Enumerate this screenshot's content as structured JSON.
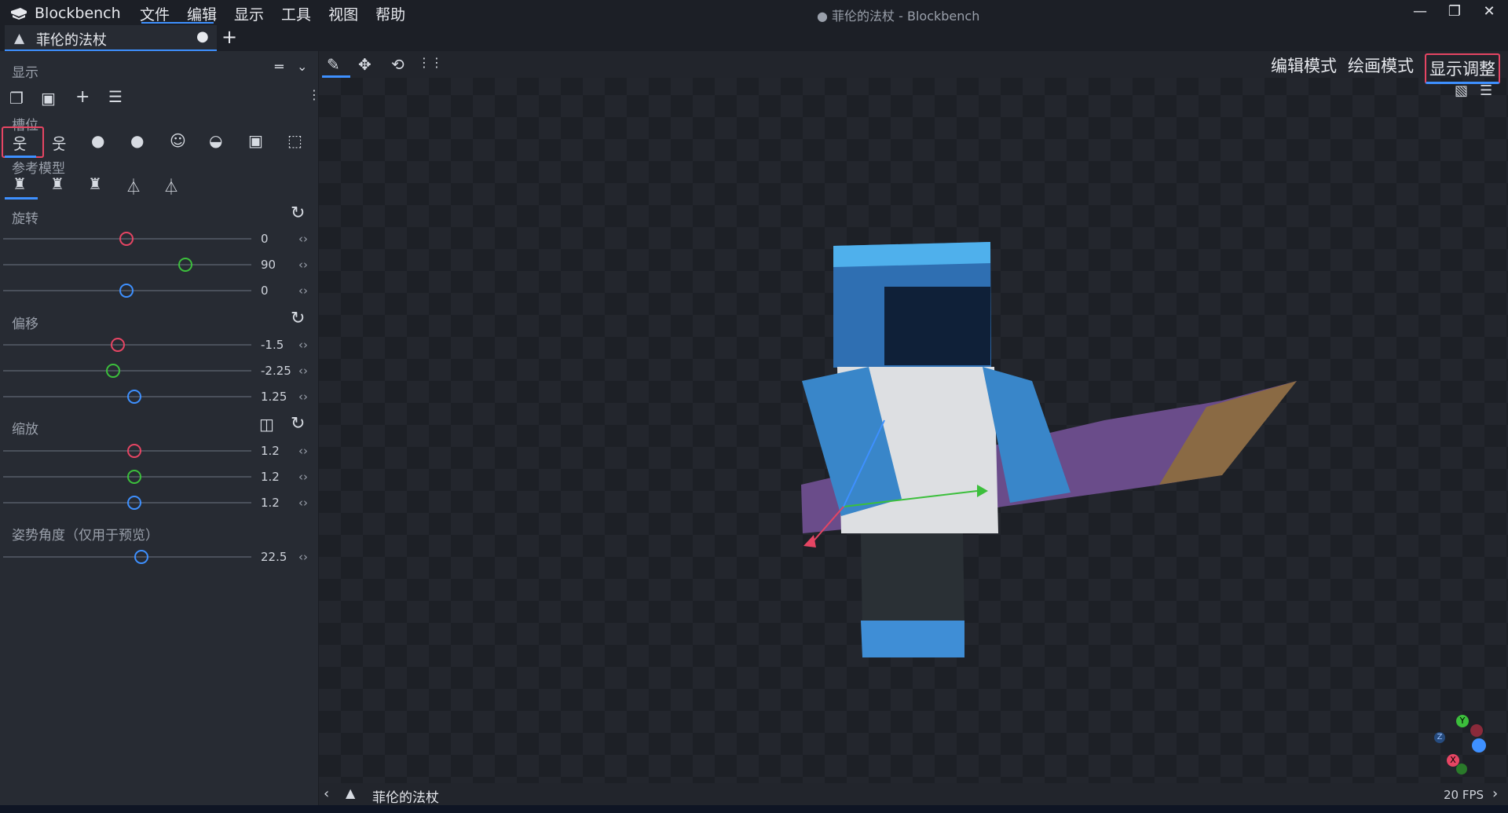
{
  "window": {
    "app_name": "Blockbench",
    "title": "● 菲伦的法杖 - Blockbench",
    "controls": {
      "minimize": "—",
      "restore": "❐",
      "close": "✕"
    }
  },
  "menu": [
    "文件",
    "编辑",
    "显示",
    "工具",
    "视图",
    "帮助"
  ],
  "tab": {
    "label": "菲伦的法杖",
    "unsaved_mark": "●",
    "add": "+"
  },
  "panel": {
    "title": "显示",
    "slots_label": "槽位",
    "reference_label": "参考模型",
    "rotation": {
      "label": "旋转",
      "values": [
        "0",
        "90",
        "0"
      ],
      "fractions": [
        0.5,
        0.75,
        0.5
      ]
    },
    "offset": {
      "label": "偏移",
      "values": [
        "-1.5",
        "-2.25",
        "1.25"
      ],
      "fractions": [
        0.47,
        0.45,
        0.53
      ]
    },
    "scale": {
      "label": "缩放",
      "values": [
        "1.2",
        "1.2",
        "1.2"
      ],
      "fractions": [
        0.53,
        0.53,
        0.53
      ]
    },
    "pose": {
      "label": "姿势角度（仅用于预览）",
      "value": "22.5",
      "fraction": 0.56
    }
  },
  "modes": [
    "编辑模式",
    "绘画模式",
    "显示调整"
  ],
  "status": {
    "model_name": "菲伦的法杖",
    "fps": "20 FPS"
  },
  "axis_gizmo": {
    "y": "Y",
    "x": "X",
    "z": "Z"
  },
  "colors": {
    "accent": "#3e90ff",
    "x_axis": "#e64563",
    "y_axis": "#3cbf3c",
    "z_axis": "#3e90ff",
    "highlight": "#e64563"
  }
}
